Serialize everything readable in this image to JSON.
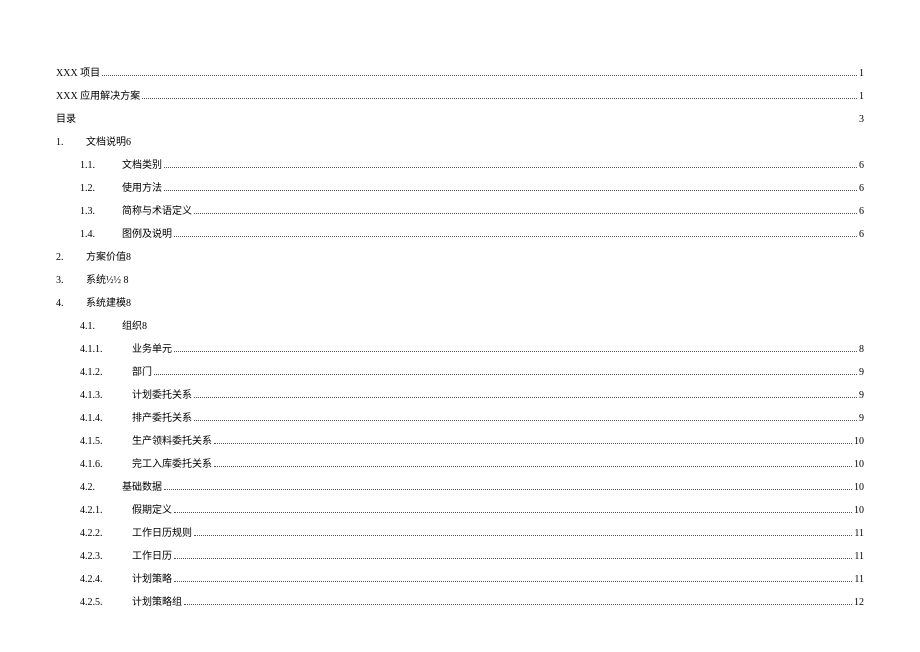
{
  "toc": [
    {
      "indent": 0,
      "num": "",
      "label": "XXX 项目",
      "page": "1",
      "dots": true
    },
    {
      "indent": 0,
      "num": "",
      "label": "XXX 应用解决方案",
      "page": "1",
      "dots": true
    },
    {
      "indent": 0,
      "num": "",
      "label": "目录",
      "page": "3",
      "dots": false,
      "spread": true
    },
    {
      "indent": 0,
      "num": "1.",
      "label": "文档说明6",
      "page": "",
      "dots": false
    },
    {
      "indent": 1,
      "num": "1.1.",
      "label": "文档类别",
      "page": "6",
      "dots": true
    },
    {
      "indent": 1,
      "num": "1.2.",
      "label": "使用方法",
      "page": "6",
      "dots": true
    },
    {
      "indent": 1,
      "num": "1.3.",
      "label": "简称与术语定义",
      "page": "6",
      "dots": true
    },
    {
      "indent": 1,
      "num": "1.4.",
      "label": "图例及说明",
      "page": "6",
      "dots": true
    },
    {
      "indent": 0,
      "num": "2.",
      "label": "方案价值8",
      "page": "",
      "dots": false
    },
    {
      "indent": 0,
      "num": "3.",
      "label": "系统½½ 8",
      "page": "",
      "dots": false
    },
    {
      "indent": 0,
      "num": "4.",
      "label": "系统建模8",
      "page": "",
      "dots": false
    },
    {
      "indent": 1,
      "num": "4.1.",
      "label": "组织8",
      "page": "",
      "dots": false
    },
    {
      "indent": 2,
      "num": "4.1.1.",
      "label": "业务单元",
      "page": "8",
      "dots": true
    },
    {
      "indent": 2,
      "num": "4.1.2.",
      "label": "部门",
      "page": "9",
      "dots": true
    },
    {
      "indent": 2,
      "num": "4.1.3.",
      "label": "计划委托关系",
      "page": "9",
      "dots": true
    },
    {
      "indent": 2,
      "num": "4.1.4.",
      "label": "排产委托关系",
      "page": "9",
      "dots": true
    },
    {
      "indent": 2,
      "num": "4.1.5.",
      "label": "生产领料委托关系",
      "page": "10",
      "dots": true
    },
    {
      "indent": 2,
      "num": "4.1.6.",
      "label": "完工入库委托关系",
      "page": "10",
      "dots": true
    },
    {
      "indent": 1,
      "num": "4.2.",
      "label": "基础数据",
      "page": "10",
      "dots": true
    },
    {
      "indent": 2,
      "num": "4.2.1.",
      "label": "假期定义",
      "page": "10",
      "dots": true
    },
    {
      "indent": 2,
      "num": "4.2.2.",
      "label": "工作日历规则",
      "page": "11",
      "dots": true
    },
    {
      "indent": 2,
      "num": "4.2.3.",
      "label": "工作日历",
      "page": "11",
      "dots": true
    },
    {
      "indent": 2,
      "num": "4.2.4.",
      "label": "计划策略",
      "page": "11",
      "dots": true
    },
    {
      "indent": 2,
      "num": "4.2.5.",
      "label": "计划策略组",
      "page": "12",
      "dots": true
    }
  ]
}
